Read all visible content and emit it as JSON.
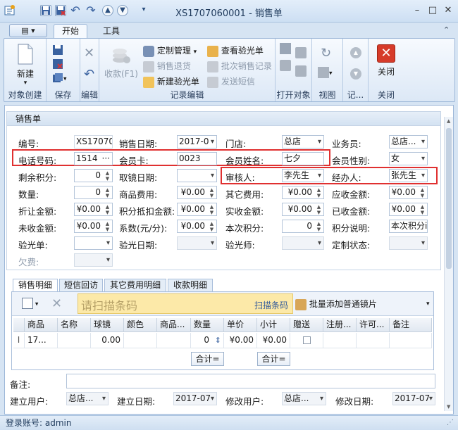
{
  "window": {
    "title": "XS1707060001 - 销售单"
  },
  "ribbon": {
    "tabs": [
      "开始",
      "工具"
    ],
    "groups": {
      "create": {
        "label": "对象创建",
        "new_label": "新建"
      },
      "save": {
        "label": "保存"
      },
      "edit": {
        "label": "编辑"
      },
      "record": {
        "label": "记录编辑",
        "collect": "收款(F1)",
        "custom_manage": "定制管理",
        "sales_return": "销售退货",
        "new_optometry": "新建验光单",
        "view_optometry": "查看验光单",
        "batch_sales": "批次销售记录",
        "send_sms": "发送短信"
      },
      "open": {
        "label": "打开对象"
      },
      "view": {
        "label": "视图"
      },
      "record2": {
        "label": "记..."
      },
      "close": {
        "label": "关闭",
        "close_label": "关闭"
      }
    }
  },
  "form": {
    "panel_title": "销售单",
    "fields": {
      "code": {
        "label": "编号:",
        "value": "XS17070"
      },
      "sale_date": {
        "label": "销售日期:",
        "value": "2017-0"
      },
      "store": {
        "label": "门店:",
        "value": "总店"
      },
      "salesman": {
        "label": "业务员:",
        "value": "总店..."
      },
      "phone": {
        "label": "电话号码:",
        "value": "1514"
      },
      "member_card": {
        "label": "会员卡:",
        "value": "0023"
      },
      "member_name": {
        "label": "会员姓名:",
        "value": "七夕"
      },
      "member_gender": {
        "label": "会员性别:",
        "value": "女"
      },
      "remaining_points": {
        "label": "剩余积分:",
        "value": "0"
      },
      "pickup_date": {
        "label": "取镜日期:",
        "value": ""
      },
      "reviewer": {
        "label": "审核人:",
        "value": "李先生"
      },
      "handler": {
        "label": "经办人:",
        "value": "张先生"
      },
      "quantity": {
        "label": "数量:",
        "value": "0"
      },
      "goods_fee": {
        "label": "商品费用:",
        "value": "¥0.00"
      },
      "other_fee": {
        "label": "其它费用:",
        "value": "¥0.00"
      },
      "receivable": {
        "label": "应收金额:",
        "value": "¥0.00"
      },
      "discount": {
        "label": "折让金额:",
        "value": "¥0.00"
      },
      "points_deduct": {
        "label": "积分抵扣金额:",
        "value": "¥0.00"
      },
      "actual_received": {
        "label": "实收金额:",
        "value": "¥0.00"
      },
      "already_received": {
        "label": "已收金额:",
        "value": "¥0.00"
      },
      "unreceived": {
        "label": "未收金额:",
        "value": "¥0.00"
      },
      "coefficient": {
        "label": "系数(元/分):",
        "value": "¥0.00"
      },
      "current_points": {
        "label": "本次积分:",
        "value": "0"
      },
      "points_note": {
        "label": "积分说明:",
        "value": "本次积分i"
      },
      "optometry_sheet": {
        "label": "验光单:",
        "value": ""
      },
      "optometry_date": {
        "label": "验光日期:",
        "value": ""
      },
      "optometrist": {
        "label": "验光师:",
        "value": ""
      },
      "custom_status": {
        "label": "定制状态:",
        "value": ""
      },
      "debt": {
        "label": "欠费:",
        "value": ""
      }
    }
  },
  "detail": {
    "tabs": [
      "销售明细",
      "短信回访",
      "其它费用明细",
      "收款明细"
    ],
    "scan_placeholder": "请扫描条码",
    "scan_button": "扫描条码",
    "batch_add": "批量添加普通镜片",
    "columns": [
      "商品",
      "名称",
      "球镜",
      "颜色",
      "商品...",
      "数量",
      "单价",
      "小计",
      "赠送",
      "注册...",
      "许可...",
      "备注"
    ],
    "row": {
      "goods": "17...",
      "name": "",
      "sphere": "0.00",
      "color": "",
      "goods2": "",
      "qty": "0",
      "price": "¥0.00",
      "subtotal": "¥0.00"
    },
    "sum_label": "合计="
  },
  "footer": {
    "remark_label": "备注:",
    "creator_label": "建立用户:",
    "creator_value": "总店...",
    "create_date_label": "建立日期:",
    "create_date_value": "2017-07",
    "modifier_label": "修改用户:",
    "modifier_value": "总店...",
    "modify_date_label": "修改日期:",
    "modify_date_value": "2017-07"
  },
  "status": {
    "login": "登录账号: admin"
  }
}
